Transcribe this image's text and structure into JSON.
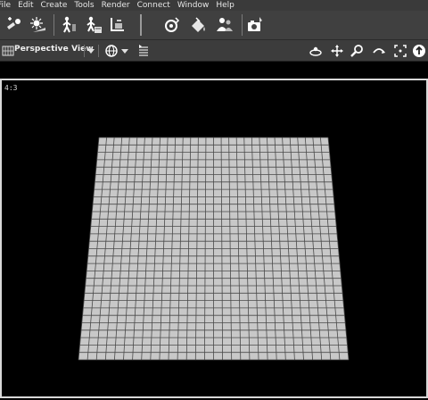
{
  "menubar": {
    "items": [
      {
        "label": "File"
      },
      {
        "label": "Edit"
      },
      {
        "label": "Create"
      },
      {
        "label": "Tools"
      },
      {
        "label": "Render"
      },
      {
        "label": "Connect"
      },
      {
        "label": "Window"
      },
      {
        "label": "Help"
      }
    ]
  },
  "toolbar": {
    "icons": [
      "add-light-icon",
      "sun-icon",
      "figure-pose-icon",
      "figure-load-icon",
      "ground-plane-icon",
      "refresh-render-icon",
      "paint-bucket-icon",
      "people-icon",
      "camera-render-icon"
    ]
  },
  "viewbar": {
    "view_name": "Perspective View",
    "icons": [
      "view-grid-icon",
      "view-dropdown-icon",
      "globe-icon",
      "globe-dropdown-icon",
      "list-icon",
      "orbit-icon",
      "pan-icon",
      "zoom-icon",
      "dolly-icon",
      "frame-icon",
      "up-icon"
    ]
  },
  "viewport": {
    "aspect_ratio": "4:3",
    "background": "#000000",
    "frame_color": "#d8d8d8",
    "ground_color": "#c8c8c8",
    "grid_line_color": "#4a4a4a"
  }
}
